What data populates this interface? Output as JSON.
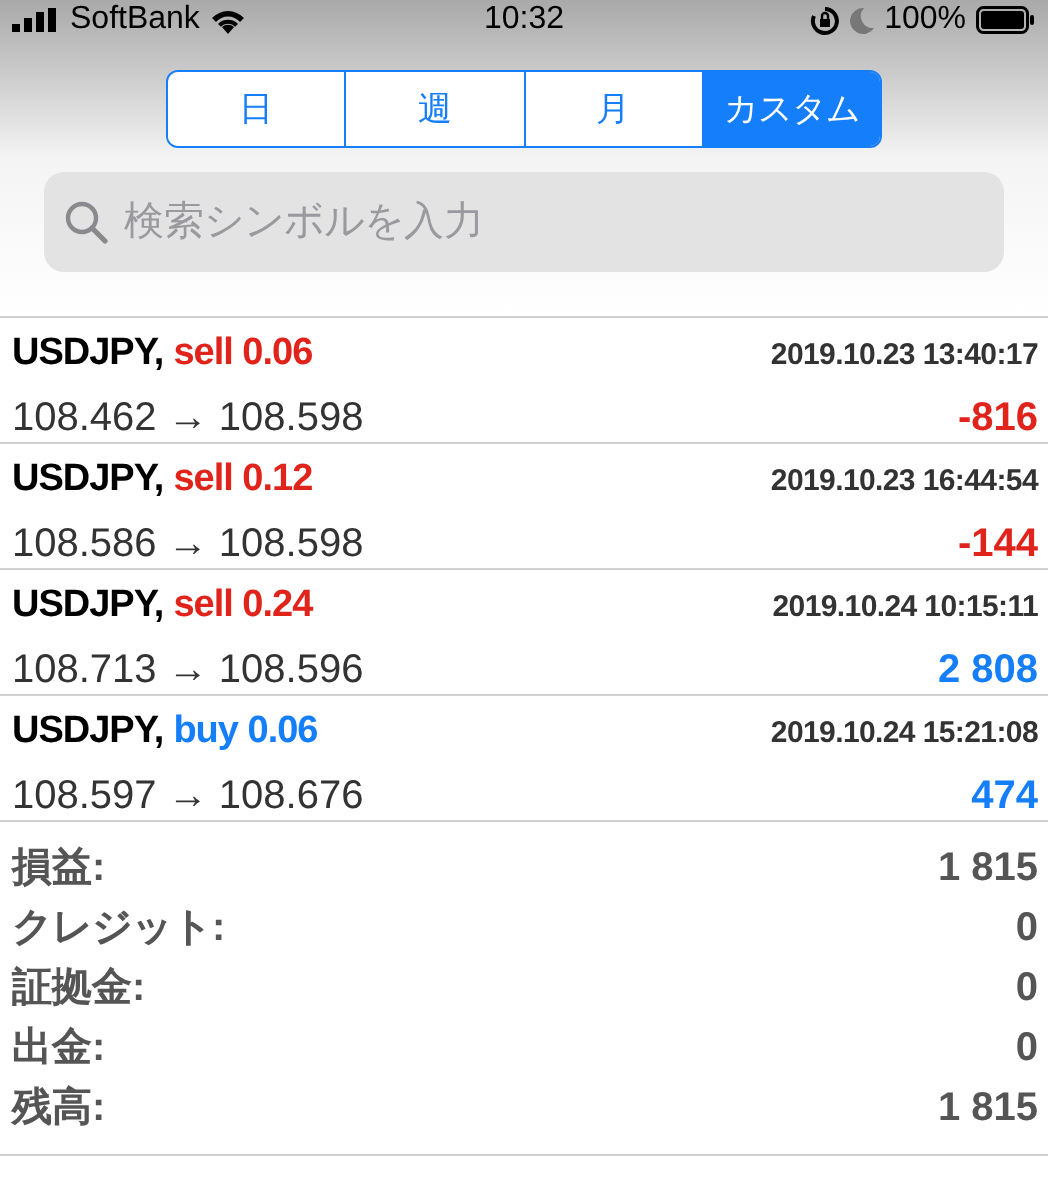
{
  "status_bar": {
    "carrier": "SoftBank",
    "time": "10:32",
    "battery": "100%"
  },
  "tabs": [
    {
      "label": "日",
      "selected": false
    },
    {
      "label": "週",
      "selected": false
    },
    {
      "label": "月",
      "selected": false
    },
    {
      "label": "カスタム",
      "selected": true
    }
  ],
  "search": {
    "placeholder": "検索シンボルを入力"
  },
  "trades": [
    {
      "symbol": "USDJPY,",
      "kind": "sell",
      "order": "sell 0.06",
      "time": "2019.10.23 13:40:17",
      "prices": "108.462 → 108.598",
      "profit": "-816",
      "color": "#e0241b"
    },
    {
      "symbol": "USDJPY,",
      "kind": "sell",
      "order": "sell 0.12",
      "time": "2019.10.23 16:44:54",
      "prices": "108.586 → 108.598",
      "profit": "-144",
      "color": "#e0241b"
    },
    {
      "symbol": "USDJPY,",
      "kind": "sell",
      "order": "sell 0.24",
      "time": "2019.10.24 10:15:11",
      "prices": "108.713 → 108.596",
      "profit": "2 808",
      "color": "#157efb"
    },
    {
      "symbol": "USDJPY,",
      "kind": "buy",
      "order": "buy 0.06",
      "time": "2019.10.24 15:21:08",
      "prices": "108.597 → 108.676",
      "profit": "474",
      "color": "#157efb"
    }
  ],
  "summary": [
    {
      "label": "損益:",
      "value": "1 815"
    },
    {
      "label": "クレジット:",
      "value": "0"
    },
    {
      "label": "証拠金:",
      "value": "0"
    },
    {
      "label": "出金:",
      "value": "0"
    },
    {
      "label": "残高:",
      "value": "1 815"
    }
  ]
}
